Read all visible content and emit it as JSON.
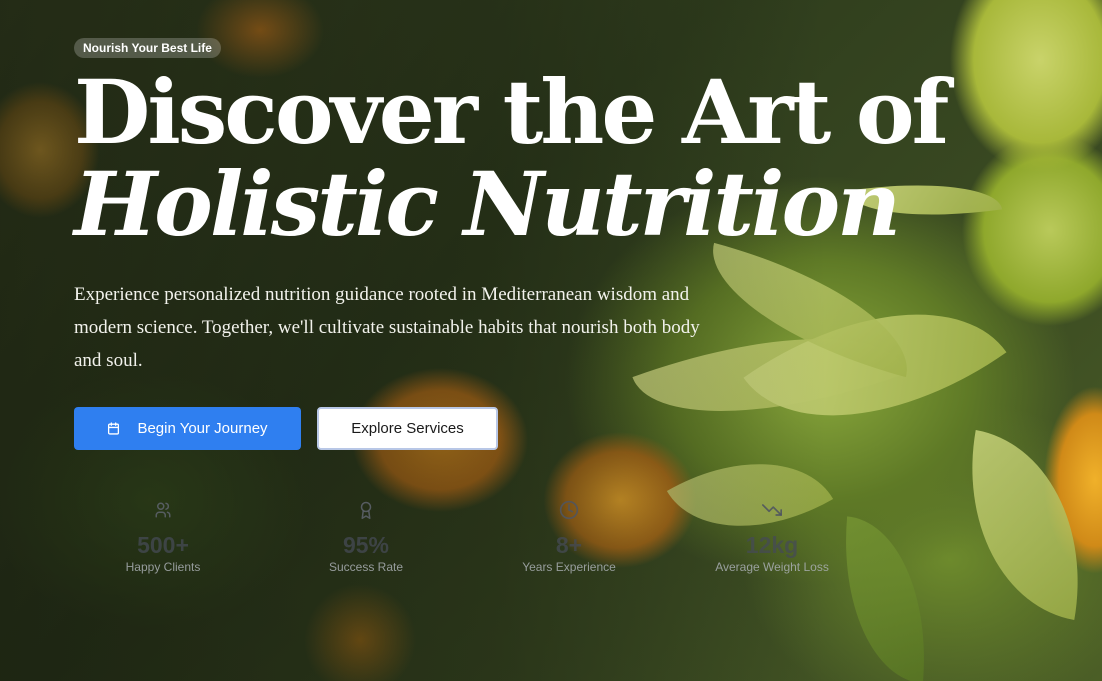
{
  "hero": {
    "badge": "Nourish Your Best Life",
    "title_line1": "Discover the Art of",
    "title_line2": "Holistic Nutrition",
    "lead": "Experience personalized nutrition guidance rooted in Mediterranean wisdom and modern science. Together, we'll cultivate sustainable habits that nourish both body and soul."
  },
  "actions": {
    "primary_label": "Begin Your Journey",
    "primary_icon": "calendar-icon",
    "secondary_label": "Explore Services"
  },
  "stats": [
    {
      "icon": "users-icon",
      "value": "500+",
      "label": "Happy Clients"
    },
    {
      "icon": "award-icon",
      "value": "95%",
      "label": "Success Rate"
    },
    {
      "icon": "clock-icon",
      "value": "8+",
      "label": "Years Experience"
    },
    {
      "icon": "trending-down-icon",
      "value": "12kg",
      "label": "Average Weight Loss"
    }
  ],
  "colors": {
    "primary": "#2f7ff0",
    "secondary_border": "#b8c7e6"
  }
}
